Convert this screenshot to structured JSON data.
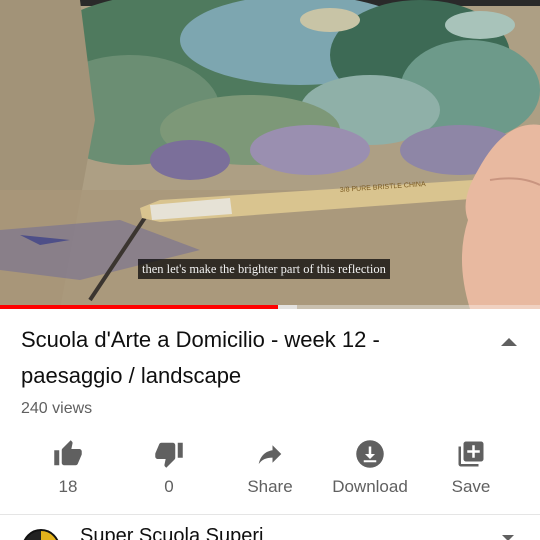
{
  "video": {
    "caption": "then let's make the brighter part of this reflection",
    "progress_played": 0.515,
    "progress_buffered": 0.55,
    "brush_text": "3/8 PURE BRISTLE CHINA",
    "colors": {
      "played": "#ff0000"
    }
  },
  "info": {
    "title": "Scuola d'Arte a Domicilio - week 12 - paesaggio / landscape",
    "views": "240 views",
    "expand_icon": "triangle-up-icon"
  },
  "actions": [
    {
      "icon": "thumb-up-icon",
      "label": "18"
    },
    {
      "icon": "thumb-down-icon",
      "label": "0"
    },
    {
      "icon": "share-icon",
      "label": "Share"
    },
    {
      "icon": "download-icon",
      "label": "Download"
    },
    {
      "icon": "playlist-add-icon",
      "label": "Save"
    }
  ],
  "channel": {
    "name": "Super Scuola Superi"
  }
}
